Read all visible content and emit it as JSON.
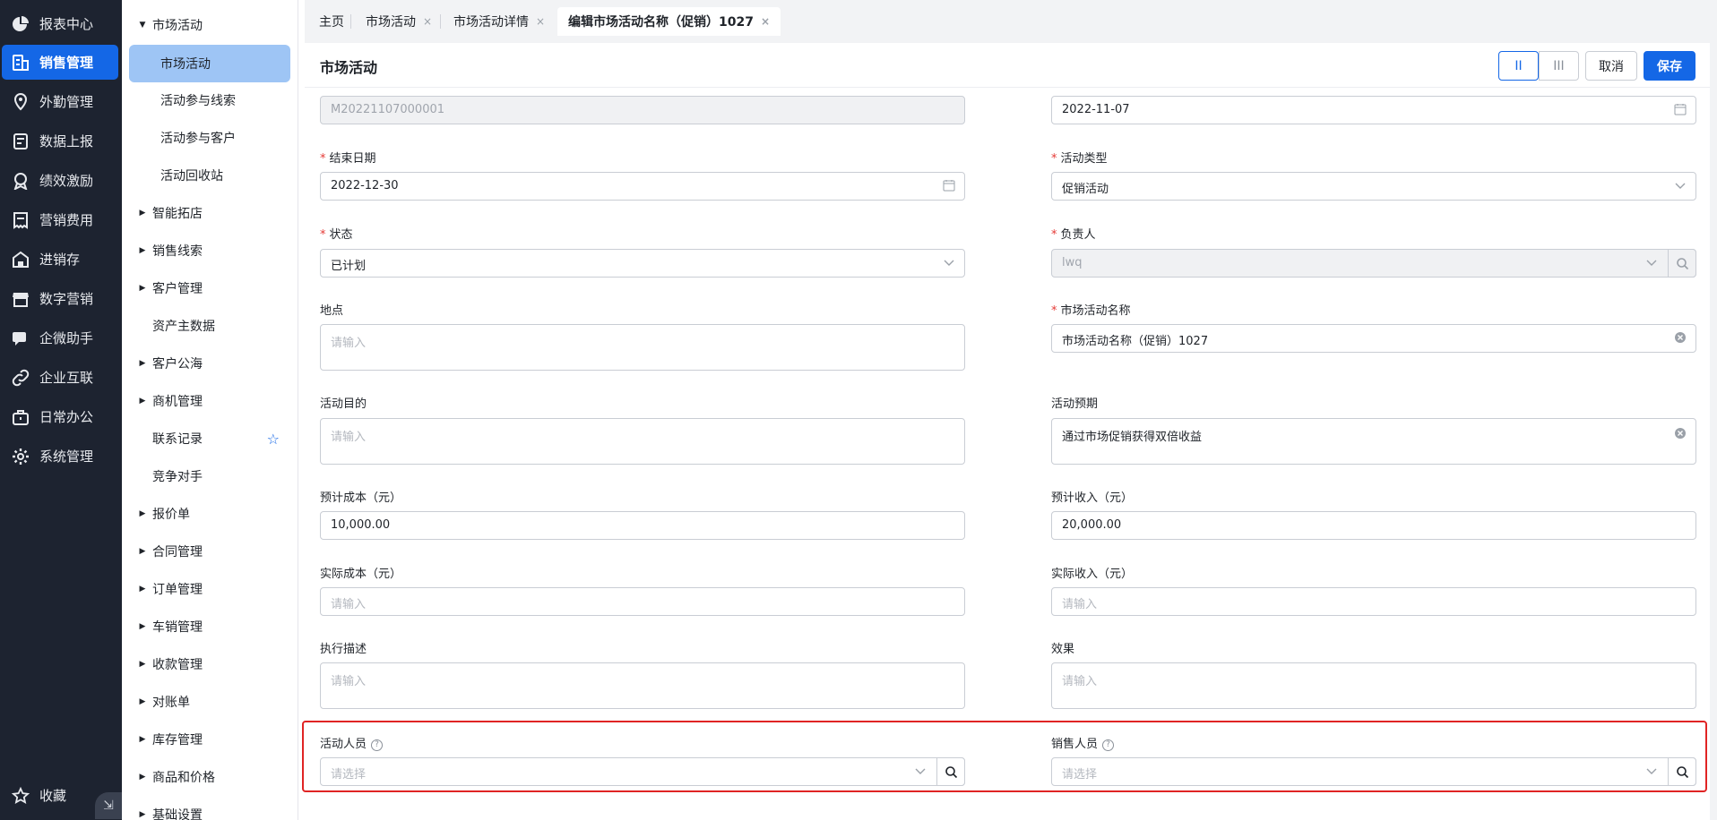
{
  "nav": {
    "items": [
      {
        "label": "报表中心",
        "icon": "pie-chart-icon"
      },
      {
        "label": "销售管理",
        "icon": "building-icon"
      },
      {
        "label": "外勤管理",
        "icon": "location-pin-icon"
      },
      {
        "label": "数据上报",
        "icon": "report-icon"
      },
      {
        "label": "绩效激励",
        "icon": "medal-icon"
      },
      {
        "label": "营销费用",
        "icon": "receipt-icon"
      },
      {
        "label": "进销存",
        "icon": "warehouse-icon"
      },
      {
        "label": "数字营销",
        "icon": "store-icon"
      },
      {
        "label": "企微助手",
        "icon": "chat-icon"
      },
      {
        "label": "企业互联",
        "icon": "link-icon"
      },
      {
        "label": "日常办公",
        "icon": "briefcase-icon"
      },
      {
        "label": "系统管理",
        "icon": "gear-icon"
      }
    ],
    "favorites_label": "收藏"
  },
  "submenu": {
    "group_label": "市场活动",
    "children": [
      "市场活动",
      "活动参与线索",
      "活动参与客户",
      "活动回收站"
    ],
    "items": [
      "智能拓店",
      "销售线索",
      "客户管理",
      "资产主数据",
      "客户公海",
      "商机管理",
      "联系记录",
      "竞争对手",
      "报价单",
      "合同管理",
      "订单管理",
      "车销管理",
      "收款管理",
      "对账单",
      "库存管理",
      "商品和价格",
      "基础设置"
    ]
  },
  "tabs": [
    "主页",
    "市场活动",
    "市场活动详情",
    "编辑市场活动名称（促销）1027"
  ],
  "header": {
    "title": "市场活动",
    "layout_two_col": "II",
    "layout_three_col": "III",
    "cancel": "取消",
    "save": "保存"
  },
  "form": {
    "code_value": "M20221107000001",
    "start_date_value": "2022-11-07",
    "end_date_label": "结束日期",
    "end_date_value": "2022-12-30",
    "type_label": "活动类型",
    "type_value": "促销活动",
    "status_label": "状态",
    "status_value": "已计划",
    "owner_label": "负责人",
    "owner_value": "lwq",
    "location_label": "地点",
    "location_placeholder": "请输入",
    "name_label": "市场活动名称",
    "name_value": "市场活动名称（促销）1027",
    "purpose_label": "活动目的",
    "purpose_placeholder": "请输入",
    "expect_label": "活动预期",
    "expect_value": "通过市场促销获得双倍收益",
    "est_cost_label": "预计成本（元）",
    "est_cost_value": "10,000.00",
    "est_income_label": "预计收入（元）",
    "est_income_value": "20,000.00",
    "act_cost_label": "实际成本（元）",
    "act_cost_placeholder": "请输入",
    "act_income_label": "实际收入（元）",
    "act_income_placeholder": "请输入",
    "exec_label": "执行描述",
    "exec_placeholder": "请输入",
    "effect_label": "效果",
    "effect_placeholder": "请输入",
    "staff_label": "活动人员",
    "staff_placeholder": "请选择",
    "sales_label": "销售人员",
    "sales_placeholder": "请选择",
    "required_mark": "*"
  },
  "colors": {
    "accent": "#1467e6",
    "nav_bg": "#1d2330",
    "submenu_active_bg": "#9ec5f5",
    "highlight_border": "#e02424",
    "required": "#e53935"
  }
}
